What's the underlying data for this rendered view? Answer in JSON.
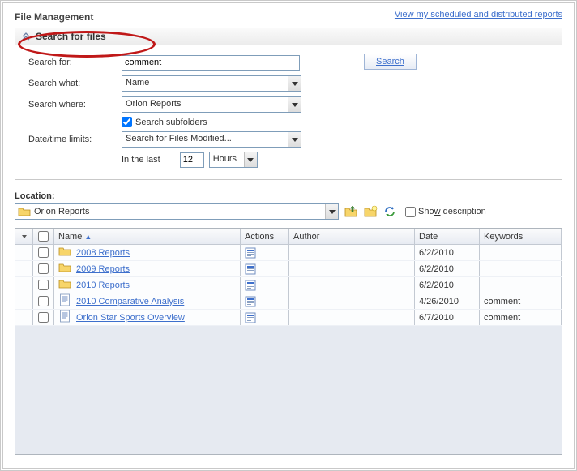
{
  "header": {
    "title": "File Management",
    "top_link": "View my scheduled and distributed reports"
  },
  "search": {
    "panel_title": "Search for files",
    "labels": {
      "search_for": "Search for:",
      "search_what": "Search what:",
      "search_where": "Search where:",
      "date_time": "Date/time limits:",
      "search_subfolders": "Search subfolders",
      "in_the_last": "In the last",
      "hours": "Hours"
    },
    "values": {
      "search_for": "comment",
      "search_what": "Name",
      "search_where": "Orion Reports",
      "date_time": "Search for Files Modified...",
      "in_last_value": "12"
    },
    "button": "Search"
  },
  "location": {
    "label": "Location:",
    "value": "Orion Reports",
    "show_desc": "Show description"
  },
  "grid": {
    "columns": {
      "name": "Name",
      "actions": "Actions",
      "author": "Author",
      "date": "Date",
      "keywords": "Keywords"
    },
    "rows": [
      {
        "type": "folder",
        "name": "2008 Reports",
        "author": "",
        "date": "6/2/2010",
        "keywords": ""
      },
      {
        "type": "folder",
        "name": "2009 Reports",
        "author": "",
        "date": "6/2/2010",
        "keywords": ""
      },
      {
        "type": "folder",
        "name": "2010 Reports",
        "author": "",
        "date": "6/2/2010",
        "keywords": ""
      },
      {
        "type": "file",
        "name": "2010 Comparative Analysis",
        "author": "",
        "date": "4/26/2010",
        "keywords": "comment"
      },
      {
        "type": "file",
        "name": "Orion Star Sports Overview",
        "author": "",
        "date": "6/7/2010",
        "keywords": "comment"
      }
    ]
  }
}
